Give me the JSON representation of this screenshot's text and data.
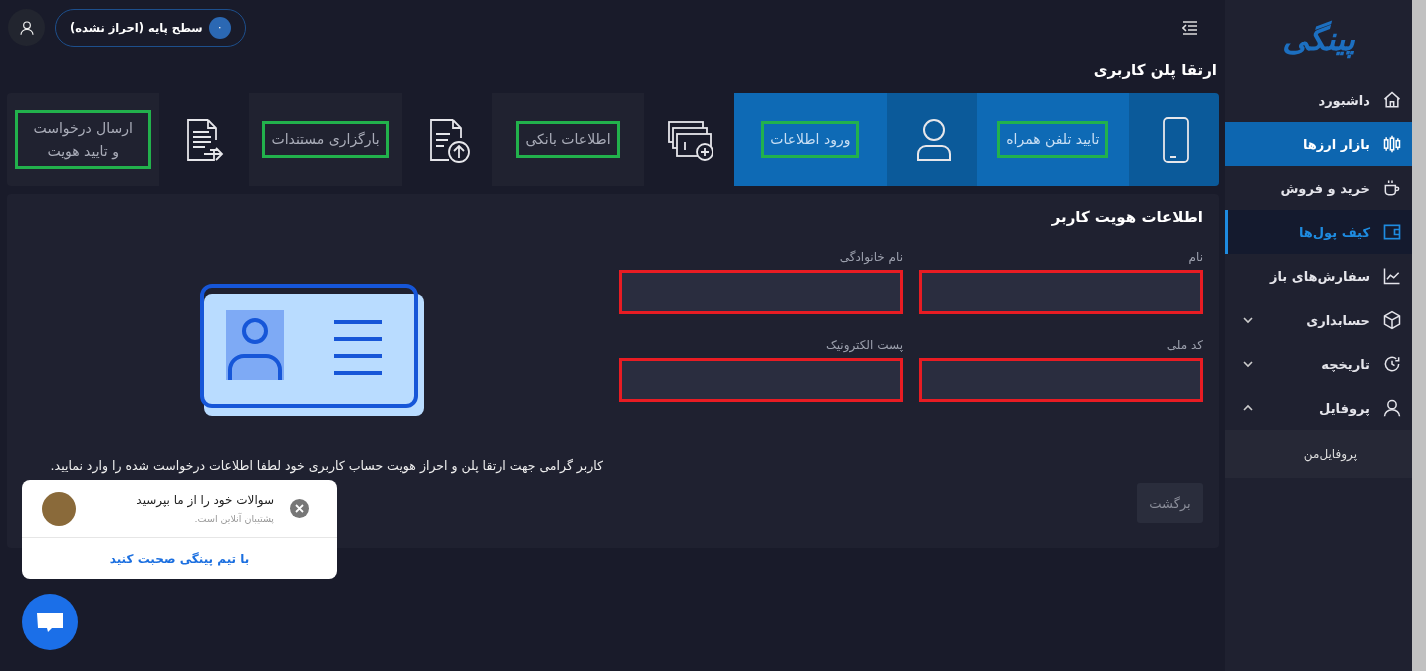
{
  "sidebar": {
    "logo": "پینگی",
    "items": [
      {
        "label": "داشبورد",
        "kind": "link",
        "selected": false,
        "highlighted": false
      },
      {
        "label": "بازار ارزها",
        "kind": "link",
        "selected": false,
        "highlighted": true
      },
      {
        "label": "خرید و فروش",
        "kind": "link",
        "selected": false,
        "highlighted": false
      },
      {
        "label": "کیف پول‌ها",
        "kind": "link",
        "selected": true,
        "highlighted": false
      },
      {
        "label": "سفارش‌های باز",
        "kind": "link",
        "selected": false,
        "highlighted": false
      },
      {
        "label": "حسابداری",
        "kind": "group",
        "expanded": false,
        "selected": false,
        "highlighted": false
      },
      {
        "label": "تاریخچه",
        "kind": "group",
        "expanded": false,
        "selected": false,
        "highlighted": false
      },
      {
        "label": "پروفایل",
        "kind": "group",
        "expanded": true,
        "selected": false,
        "highlighted": false,
        "children": [
          {
            "label": "پروفایل‌من",
            "selected": false
          }
        ]
      }
    ]
  },
  "header": {
    "level_badge": {
      "number": "۰",
      "label": "سطح پایه (احراز نشده)"
    }
  },
  "page_title": "ارتقا پلن کاربری",
  "steps": [
    {
      "label": "تایید تلفن همراه",
      "done": true,
      "outlined": true
    },
    {
      "label": "ورود اطلاعات",
      "done": true,
      "outlined": true
    },
    {
      "label": "اطلاعات بانکی",
      "done": false,
      "outlined": true
    },
    {
      "label": "بارگزاری مستندات",
      "done": false,
      "outlined": true
    },
    {
      "label": "ارسال درخواست و تایید هویت",
      "done": false,
      "outlined": true
    }
  ],
  "identity_form": {
    "title": "اطلاعات هویت کاربر",
    "fields": [
      {
        "label": "نام",
        "invalid": true
      },
      {
        "label": "نام خانوادگی",
        "invalid": true
      },
      {
        "label": "کد ملی",
        "invalid": true
      },
      {
        "label": "پست الکترونیک",
        "invalid": true
      }
    ],
    "note": "کاربر گرامی جهت ارتقا پلن و احراز هویت حساب کاربری خود لطفا اطلاعات درخواست شده را وارد نمایید.",
    "back_button": "برگشت"
  },
  "chat": {
    "title": "سوالات خود را از ما بپرسید",
    "subtitle": "پشتیبان آنلاین است.",
    "link": "با تیم پینگی صحبت کنید"
  }
}
